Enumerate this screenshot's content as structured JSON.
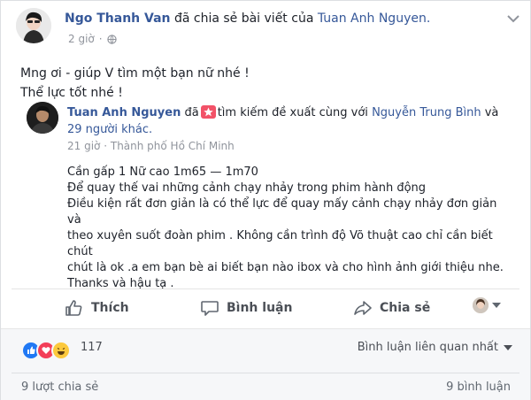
{
  "post": {
    "author": "Ngo Thanh Van",
    "action_text": "đã chia sẻ bài viết của",
    "shared_from": "Tuan Anh Nguyen.",
    "time": "2 giờ",
    "privacy_icon": "globe-icon",
    "text_line1": "Mng ơi - giúp V tìm một bạn nữ nhé !",
    "text_line2": "Thể lực tốt nhé !"
  },
  "shared": {
    "author": "Tuan Anh Nguyen",
    "verb1": "đã",
    "verb2": "tìm kiếm đề xuất cùng với",
    "tagged": "Nguyễn Trung Bình",
    "conj": "và",
    "others": "29 người khác.",
    "time": "21 giờ",
    "location": "Thành phố Hồ Chí Minh",
    "lines": [
      "Cần gấp 1 Nữ cao 1m65 — 1m70",
      "Để quay thế vai những cảnh chạy nhảy trong phim hành động",
      "Điều kiện rất đơn giản là có thể lực để quay mấy cảnh chạy nhảy đơn giản và",
      "theo xuyên suốt đoàn phim . Không cần trình độ Võ thuật cao chỉ cần biết chút",
      "chút là ok .a em bạn bè ai biết bạn nào ibox và cho hình ảnh giới thiệu nhe.",
      "Thanks và hậu tạ ."
    ]
  },
  "actions": {
    "like": "Thích",
    "comment": "Bình luận",
    "share": "Chia sẻ"
  },
  "footer": {
    "reaction_count": "117",
    "sort_label": "Bình luận liên quan nhất",
    "shares": "9 lượt chia sẻ",
    "comments": "9 bình luận"
  },
  "colors": {
    "link": "#365899",
    "like_blue": "#2078f4",
    "love_red": "#f33e58",
    "haha_yellow": "#fcc93d"
  }
}
